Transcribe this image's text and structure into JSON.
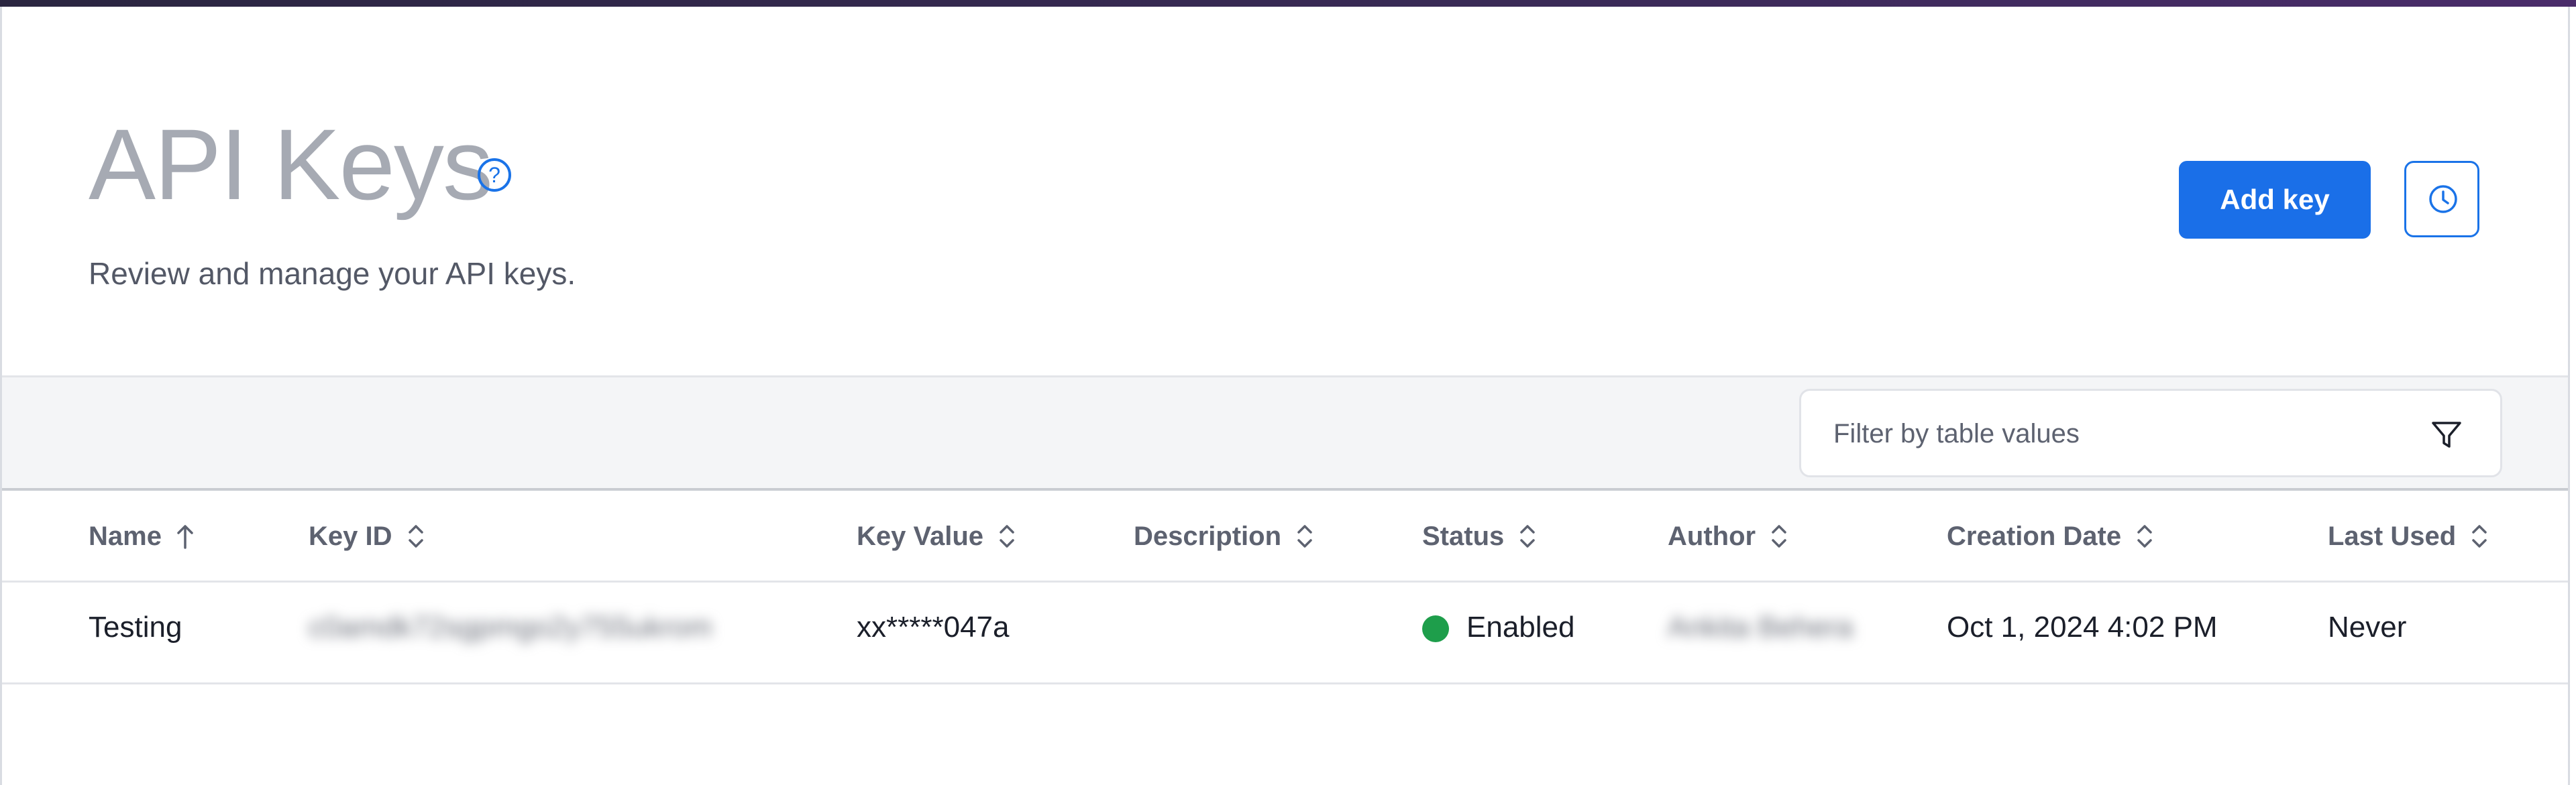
{
  "header": {
    "title": "API Keys",
    "subtitle": "Review and manage your API keys.",
    "help_icon": "question-circle-icon",
    "add_button_label": "Add key",
    "history_icon": "clock-icon"
  },
  "filter": {
    "placeholder": "Filter by table values",
    "value": "",
    "icon": "funnel-icon"
  },
  "table": {
    "columns": [
      {
        "label": "Name",
        "sort": "ascending"
      },
      {
        "label": "Key ID",
        "sort": "none"
      },
      {
        "label": "Key Value",
        "sort": "none"
      },
      {
        "label": "Description",
        "sort": "none"
      },
      {
        "label": "Status",
        "sort": "none"
      },
      {
        "label": "Author",
        "sort": "none"
      },
      {
        "label": "Creation Date",
        "sort": "none"
      },
      {
        "label": "Last Used",
        "sort": "none"
      }
    ],
    "rows": [
      {
        "name": "Testing",
        "key_id": "c0amdk72sgpmgo2y755ukrom",
        "key_value": "xx*****047a",
        "description": "",
        "status": "Enabled",
        "status_color": "#1e9e4b",
        "author": "Ankita Behera",
        "creation_date": "Oct 1, 2024 4:02 PM",
        "last_used": "Never"
      }
    ]
  },
  "colors": {
    "accent": "#1a6fe8",
    "status_enabled": "#1e9e4b"
  }
}
